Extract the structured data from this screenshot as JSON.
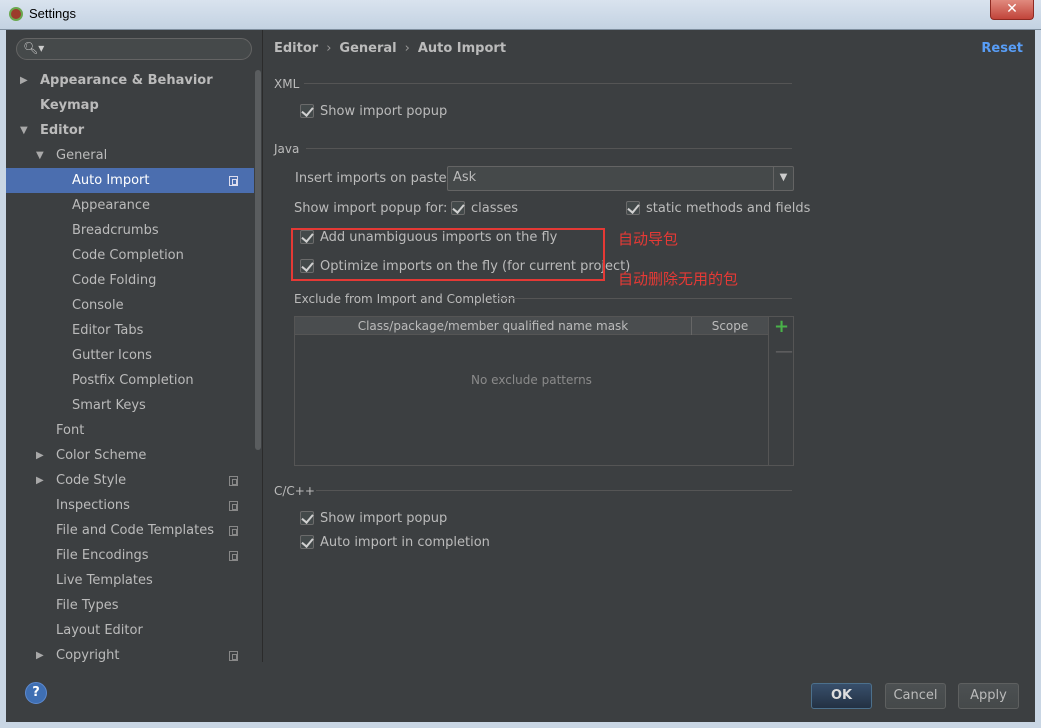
{
  "window": {
    "title": "Settings",
    "close_glyph": "✕"
  },
  "search": {
    "placeholder": ""
  },
  "sidebar": {
    "items": [
      {
        "label": "Appearance & Behavior",
        "level": 0,
        "arrow": "▶",
        "bold": true
      },
      {
        "label": "Keymap",
        "level": 0,
        "arrow": "",
        "bold": true
      },
      {
        "label": "Editor",
        "level": 0,
        "arrow": "▼",
        "bold": true
      },
      {
        "label": "General",
        "level": 1,
        "arrow": "▼"
      },
      {
        "label": "Auto Import",
        "level": 2,
        "arrow": "",
        "selected": true,
        "badge": true
      },
      {
        "label": "Appearance",
        "level": 2,
        "arrow": ""
      },
      {
        "label": "Breadcrumbs",
        "level": 2,
        "arrow": ""
      },
      {
        "label": "Code Completion",
        "level": 2,
        "arrow": ""
      },
      {
        "label": "Code Folding",
        "level": 2,
        "arrow": ""
      },
      {
        "label": "Console",
        "level": 2,
        "arrow": ""
      },
      {
        "label": "Editor Tabs",
        "level": 2,
        "arrow": ""
      },
      {
        "label": "Gutter Icons",
        "level": 2,
        "arrow": ""
      },
      {
        "label": "Postfix Completion",
        "level": 2,
        "arrow": ""
      },
      {
        "label": "Smart Keys",
        "level": 2,
        "arrow": ""
      },
      {
        "label": "Font",
        "level": 1,
        "arrow": ""
      },
      {
        "label": "Color Scheme",
        "level": 1,
        "arrow": "▶"
      },
      {
        "label": "Code Style",
        "level": 1,
        "arrow": "▶",
        "badge": true
      },
      {
        "label": "Inspections",
        "level": 1,
        "arrow": "",
        "badge": true
      },
      {
        "label": "File and Code Templates",
        "level": 1,
        "arrow": "",
        "badge": true
      },
      {
        "label": "File Encodings",
        "level": 1,
        "arrow": "",
        "badge": true
      },
      {
        "label": "Live Templates",
        "level": 1,
        "arrow": ""
      },
      {
        "label": "File Types",
        "level": 1,
        "arrow": ""
      },
      {
        "label": "Layout Editor",
        "level": 1,
        "arrow": ""
      },
      {
        "label": "Copyright",
        "level": 1,
        "arrow": "▶",
        "badge": true
      }
    ]
  },
  "breadcrumb": {
    "part1": "Editor",
    "part2": "General",
    "part3": "Auto Import",
    "sep": "›"
  },
  "reset_label": "Reset",
  "xml": {
    "section": "XML",
    "show_import_popup": "Show import popup"
  },
  "java": {
    "section": "Java",
    "insert_imports_label": "Insert imports on paste:",
    "insert_imports_value": "Ask",
    "show_popup_for_label": "Show import popup for:",
    "classes_label": "classes",
    "static_label": "static methods and fields",
    "add_unambiguous": "Add unambiguous imports on the fly",
    "optimize_imports": "Optimize imports on the fly (for current project)"
  },
  "annotations": {
    "auto_import": "自动导包",
    "auto_remove": "自动删除无用的包"
  },
  "exclude": {
    "section": "Exclude from Import and Completion",
    "col_mask": "Class/package/member qualified name mask",
    "col_scope": "Scope",
    "empty_text": "No exclude patterns",
    "add_glyph": "+",
    "remove_glyph": "—"
  },
  "cpp": {
    "section": "C/C++",
    "show_import_popup": "Show import popup",
    "auto_import_completion": "Auto import in completion"
  },
  "footer": {
    "help_glyph": "?",
    "ok": "OK",
    "cancel": "Cancel",
    "apply": "Apply"
  },
  "colors": {
    "background": "#3c3f41",
    "selection": "#4b6eaf",
    "link": "#589df6",
    "annotation": "#e53935",
    "add_icon": "#49b249"
  }
}
